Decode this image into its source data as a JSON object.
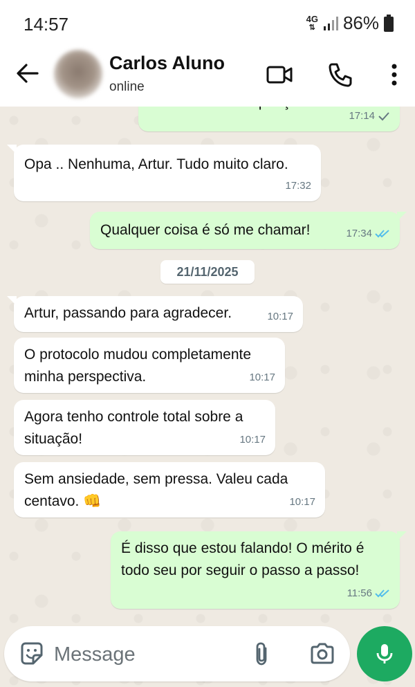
{
  "status_bar": {
    "time": "14:57",
    "network": "4G",
    "battery": "86%"
  },
  "header": {
    "name": "Carlos Aluno",
    "status": "online"
  },
  "messages": [
    {
      "dir": "out",
      "lines": [
        "exercícios de respiração?"
      ],
      "time": "17:14",
      "ticks": "sent"
    },
    {
      "dir": "in",
      "lines": [
        "Opa .. Nenhuma, Artur. Tudo muito claro."
      ],
      "time": "17:32"
    },
    {
      "dir": "out",
      "lines": [
        "Qualquer coisa é só me chamar!"
      ],
      "time": "17:34",
      "ticks": "read"
    },
    {
      "dir": "in",
      "lines": [
        "Artur, passando para agradecer."
      ],
      "time": "10:17"
    },
    {
      "dir": "in",
      "lines": [
        "O protocolo mudou completamente",
        "minha perspectiva."
      ],
      "time": "10:17"
    },
    {
      "dir": "in",
      "lines": [
        "Agora tenho controle total sobre a",
        "situação!"
      ],
      "time": "10:17"
    },
    {
      "dir": "in",
      "lines": [
        "Sem ansiedade, sem pressa. Valeu cada",
        "centavo. 👊"
      ],
      "time": "10:17"
    },
    {
      "dir": "out",
      "lines": [
        "É disso que estou falando! O mérito é",
        "todo seu por seguir o passo a passo!"
      ],
      "time": "11:56",
      "ticks": "read"
    }
  ],
  "date_divider": "21/11/2025",
  "input": {
    "placeholder": "Message"
  },
  "colors": {
    "outgoing_bubble": "#d9fdd3",
    "incoming_bubble": "#ffffff",
    "accent_green": "#1daa61",
    "read_tick": "#53bdeb"
  }
}
